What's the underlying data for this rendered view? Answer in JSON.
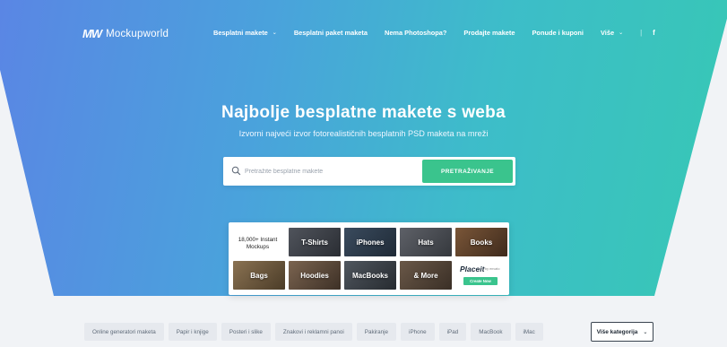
{
  "colors": {
    "gradient_start": "#5a86e4",
    "gradient_end": "#37c8b4",
    "accent_green": "#3ac48d",
    "page_bg": "#f1f3f6"
  },
  "brand": {
    "logo_mark": "MW",
    "name": "Mockupworld"
  },
  "nav": {
    "items": [
      {
        "label": "Besplatni makete",
        "has_dropdown": true
      },
      {
        "label": "Besplatni paket maketa",
        "has_dropdown": false
      },
      {
        "label": "Nema Photoshopa?",
        "has_dropdown": false
      },
      {
        "label": "Prodajte makete",
        "has_dropdown": false
      },
      {
        "label": "Ponude i kuponi",
        "has_dropdown": false
      },
      {
        "label": "Više",
        "has_dropdown": true
      }
    ],
    "separator": "|",
    "facebook": "f"
  },
  "hero": {
    "title": "Najbolje besplatne makete s weba",
    "subtitle": "Izvorni najveći izvor fotorealističnih besplatnih PSD maketa na mreži"
  },
  "search": {
    "placeholder": "Pretražite besplatne makete",
    "button_label": "PRETRAŽIVANJE",
    "icon": "search-icon"
  },
  "placeit_card": {
    "intro_line1": "18,000+ Instant",
    "intro_line2": "Mockups",
    "tiles": [
      {
        "label": "T-Shirts",
        "color": "#3b3f46"
      },
      {
        "label": "iPhones",
        "color": "#2c3a4a"
      },
      {
        "label": "Hats",
        "color": "#4a4d52"
      },
      {
        "label": "Books",
        "color": "#5a4030"
      },
      {
        "label": "Bags",
        "color": "#6b5a42"
      },
      {
        "label": "Hoodies",
        "color": "#5a4a3c"
      },
      {
        "label": "MacBooks",
        "color": "#3a3f45"
      },
      {
        "label": "& More",
        "color": "#4f4238"
      }
    ],
    "logo": "Placeit",
    "by": "by envato",
    "cta": "Create Now"
  },
  "categories": [
    "Online generatori maketa",
    "Papir i knjige",
    "Posteri i slike",
    "Znakovi i reklamni panoi",
    "Pakiranje",
    "iPhone",
    "iPad",
    "MacBook",
    "iMac"
  ],
  "more_categories": "Više kategorija"
}
